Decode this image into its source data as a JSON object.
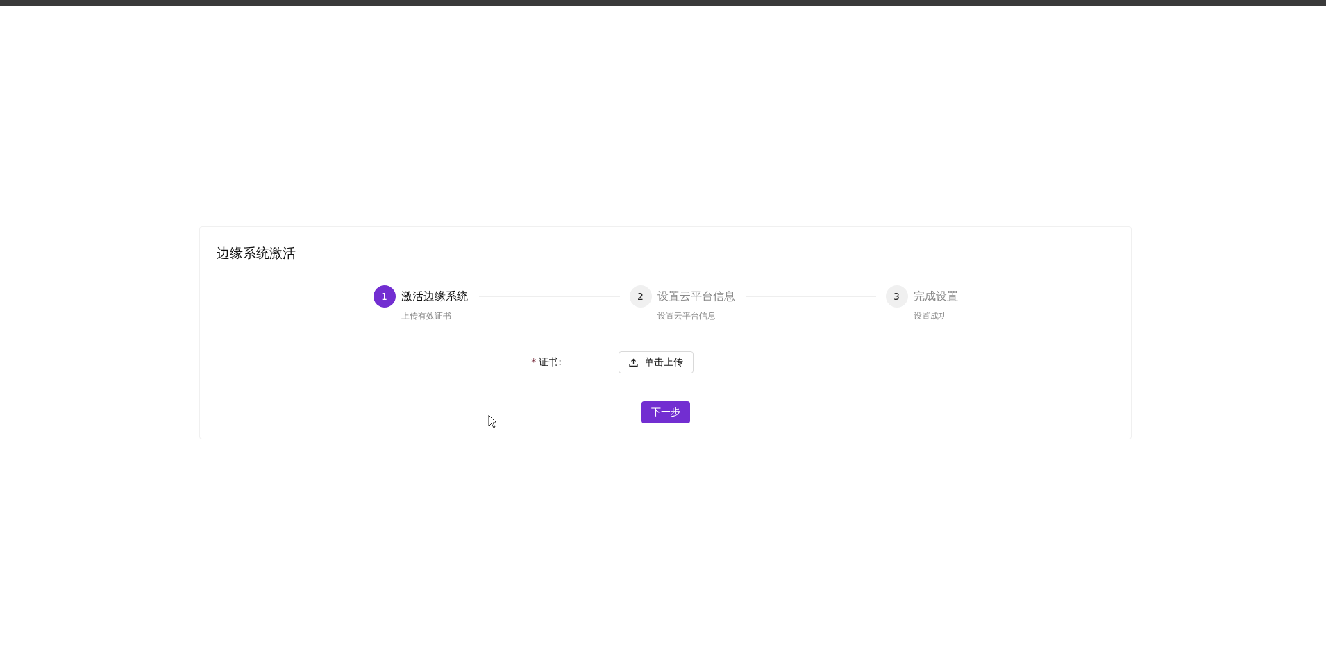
{
  "card": {
    "title": "边缘系统激活"
  },
  "steps": [
    {
      "number": "1",
      "title": "激活边缘系统",
      "description": "上传有效证书",
      "selected": true
    },
    {
      "number": "2",
      "title": "设置云平台信息",
      "description": "设置云平台信息",
      "selected": false
    },
    {
      "number": "3",
      "title": "完成设置",
      "description": "设置成功",
      "selected": false
    }
  ],
  "form": {
    "required_mark": "*",
    "label": "证书:",
    "upload_button": "单击上传"
  },
  "next_button": "下一步"
}
